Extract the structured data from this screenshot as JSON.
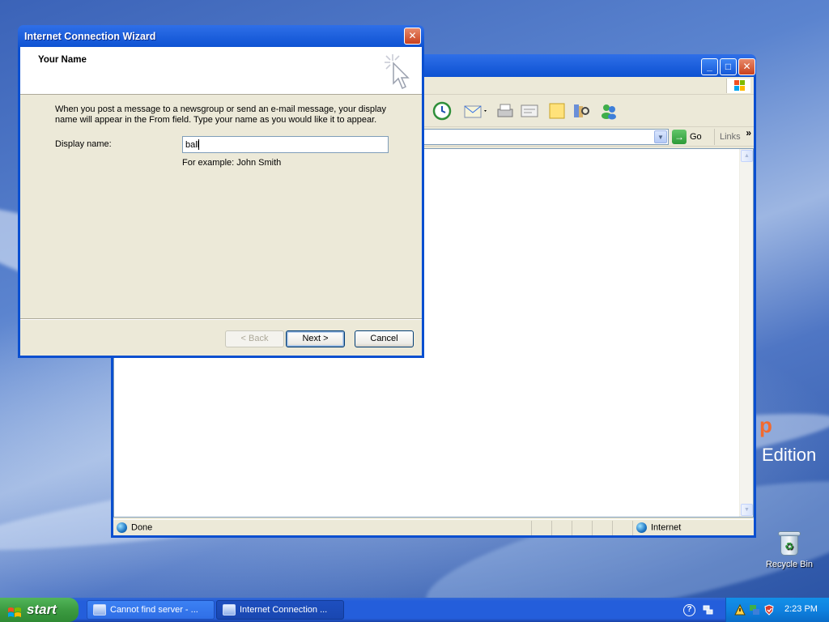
{
  "desktop": {
    "edition_mark": "p",
    "edition_text": "Edition",
    "recycle_bin_label": "Recycle Bin"
  },
  "browser": {
    "go_label": "Go",
    "links_label": "Links",
    "links_chevron": "»",
    "status_text": "Done",
    "zone_text": "Internet"
  },
  "wizard": {
    "title": "Internet Connection Wizard",
    "header_title": "Your Name",
    "instructions": "When you post a message to a newsgroup or send an e-mail message, your display name will appear in the From field.  Type your name as you would like it to appear.",
    "display_name_label": "Display name:",
    "display_name_value": "ball",
    "example_text": "For example: John Smith",
    "back_label": "< Back",
    "next_label": "Next >",
    "cancel_label": "Cancel",
    "close_glyph": "✕"
  },
  "window_controls": {
    "minimize_glyph": "_",
    "maximize_glyph": "□",
    "close_glyph": "✕"
  },
  "taskbar": {
    "start_label": "start",
    "tasks": [
      {
        "label": "Cannot find server - ..."
      },
      {
        "label": "Internet Connection ..."
      }
    ],
    "help_glyph": "?",
    "clock": "2:23 PM"
  },
  "colors": {
    "xp_blue": "#0a4fd0",
    "dialog_face": "#ece9d8",
    "start_green": "#3c9b41"
  }
}
